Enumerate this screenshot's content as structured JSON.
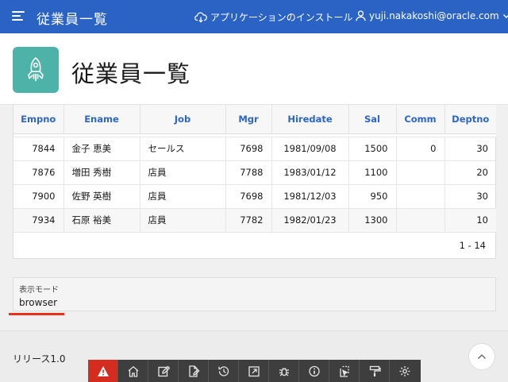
{
  "header": {
    "app_title": "従業員一覧",
    "install_label": "アプリケーションのインストール",
    "user_name": "yuji.nakakoshi@oracle.com"
  },
  "page": {
    "title": "従業員一覧"
  },
  "report": {
    "columns": [
      "Empno",
      "Ename",
      "Job",
      "Mgr",
      "Hiredate",
      "Sal",
      "Comm",
      "Deptno"
    ],
    "rows": [
      [
        "7844",
        "金子 恵美",
        "セールス",
        "7698",
        "1981/09/08",
        "1500",
        "0",
        "30"
      ],
      [
        "7876",
        "増田 秀樹",
        "店員",
        "7788",
        "1983/01/12",
        "1100",
        "",
        "20"
      ],
      [
        "7900",
        "佐野 英樹",
        "店員",
        "7698",
        "1981/12/03",
        "950",
        "",
        "30"
      ],
      [
        "7934",
        "石原 裕美",
        "店員",
        "7782",
        "1982/01/23",
        "1300",
        "",
        "10"
      ]
    ],
    "pagination": "1 - 14"
  },
  "display_mode": {
    "label": "表示モード",
    "value": "browser"
  },
  "footer": {
    "release": "リリース1.0"
  },
  "dev_toolbar": {
    "icons": [
      "warning-icon",
      "home-icon",
      "edit-icon",
      "edit-page-icon",
      "history-icon",
      "share-icon",
      "debug-icon",
      "info-icon",
      "select-icon",
      "theme-icon",
      "settings-icon"
    ]
  },
  "colors": {
    "header_bg": "#2b63c4",
    "column_header_text": "#2d66c4",
    "hero_icon_bg": "#4db3a8",
    "warning_bg": "#d42c1e"
  }
}
